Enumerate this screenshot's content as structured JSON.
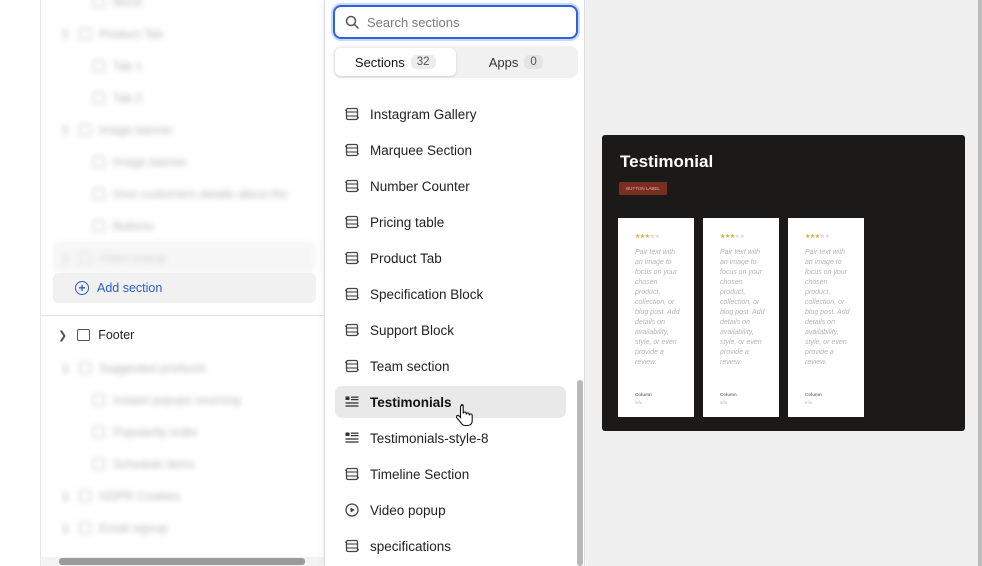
{
  "tree": {
    "blurred_items": [
      {
        "label": "Block",
        "indent": 2
      },
      {
        "label": "Product Tab",
        "indent": 1
      },
      {
        "label": "Tab 1",
        "indent": 2
      },
      {
        "label": "Tab 2",
        "indent": 2
      },
      {
        "label": "Image banner",
        "indent": 1
      },
      {
        "label": "Image banner",
        "indent": 2
      },
      {
        "label": "Give customers details about the",
        "indent": 2
      },
      {
        "label": "Buttons",
        "indent": 2
      },
      {
        "label": "Video popup",
        "indent": 1
      }
    ],
    "add_section_label": "Add section",
    "footer_label": "Footer",
    "blurred_footer_items": [
      {
        "label": "Suggested products",
        "indent": 1
      },
      {
        "label": "Instant popups sourcing",
        "indent": 2
      },
      {
        "label": "Popularity order",
        "indent": 2
      },
      {
        "label": "Schedule items",
        "indent": 2
      },
      {
        "label": "GDPR Cookies",
        "indent": 1
      },
      {
        "label": "Email signup",
        "indent": 1
      }
    ]
  },
  "search": {
    "placeholder": "Search sections",
    "value": ""
  },
  "tabs": [
    {
      "label": "Sections",
      "count": "32",
      "active": true
    },
    {
      "label": "Apps",
      "count": "0",
      "active": false
    }
  ],
  "sections": [
    {
      "label": "Instagram Gallery",
      "icon": "section-grid-icon"
    },
    {
      "label": "Marquee Section",
      "icon": "section-grid-icon"
    },
    {
      "label": "Number Counter",
      "icon": "section-grid-icon"
    },
    {
      "label": "Pricing table",
      "icon": "section-grid-icon"
    },
    {
      "label": "Product Tab",
      "icon": "section-grid-icon"
    },
    {
      "label": "Specification Block",
      "icon": "section-grid-icon"
    },
    {
      "label": "Support Block",
      "icon": "section-grid-icon"
    },
    {
      "label": "Team section",
      "icon": "section-grid-icon"
    },
    {
      "label": "Testimonials",
      "icon": "quote-list-icon",
      "selected": true
    },
    {
      "label": "Testimonials-style-8",
      "icon": "quote-list-icon"
    },
    {
      "label": "Timeline Section",
      "icon": "section-grid-icon"
    },
    {
      "label": "Video popup",
      "icon": "play-circle-icon"
    },
    {
      "label": "specifications",
      "icon": "section-grid-icon"
    }
  ],
  "preview": {
    "title": "Testimonial",
    "button_label": "BUTTON LABEL",
    "card_text": "Pair text with an image to focus on your chosen product, collection, or blog post. Add details on availability, style, or even provide a review.",
    "author": "Column",
    "author_sub": "info",
    "cards": 3
  },
  "colors": {
    "accent": "#2d63d9",
    "preview_bg": "#1c1a18",
    "button": "#7a2e1f",
    "stars": "#e2a62a"
  }
}
